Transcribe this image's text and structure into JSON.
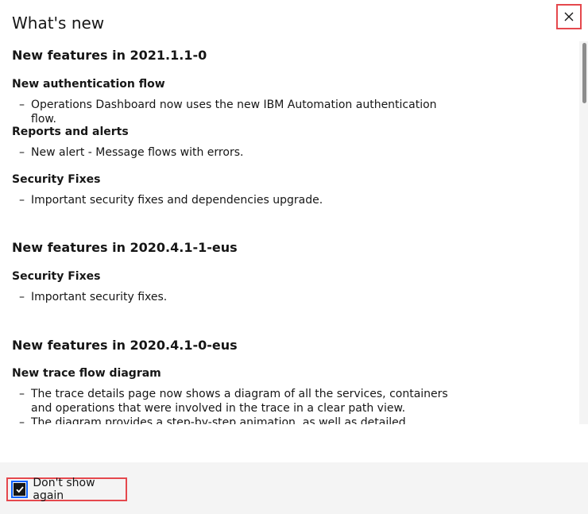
{
  "modal": {
    "title": "What's new",
    "close_icon": "close-icon"
  },
  "sections": [
    {
      "heading": "New features in 2021.1.1-0",
      "items": [
        {
          "title": "New authentication flow",
          "bullets": [
            "Operations Dashboard now uses the new IBM Automation authentication flow."
          ]
        },
        {
          "title": "Reports and alerts",
          "bullets": [
            "New alert - Message flows with errors."
          ]
        },
        {
          "title": "Security Fixes",
          "bullets": [
            "Important security fixes and dependencies upgrade."
          ]
        }
      ]
    },
    {
      "heading": "New features in 2020.4.1-1-eus",
      "items": [
        {
          "title": "Security Fixes",
          "bullets": [
            "Important security fixes."
          ]
        }
      ]
    },
    {
      "heading": "New features in 2020.4.1-0-eus",
      "items": [
        {
          "title": "New trace flow diagram",
          "bullets": [
            "The trace details page now shows a diagram of all the services, containers and operations that were involved in the trace in a clear path view.",
            "The diagram provides a step-by-step animation, as well as detailed information, on"
          ]
        }
      ]
    }
  ],
  "bullet_marker": "–",
  "footer": {
    "checkbox_label": "Don't show again",
    "checkbox_checked": true
  },
  "colors": {
    "highlight_border": "#e5484d",
    "focus_outline": "#0f62fe",
    "footer_bg": "#f4f4f4"
  }
}
